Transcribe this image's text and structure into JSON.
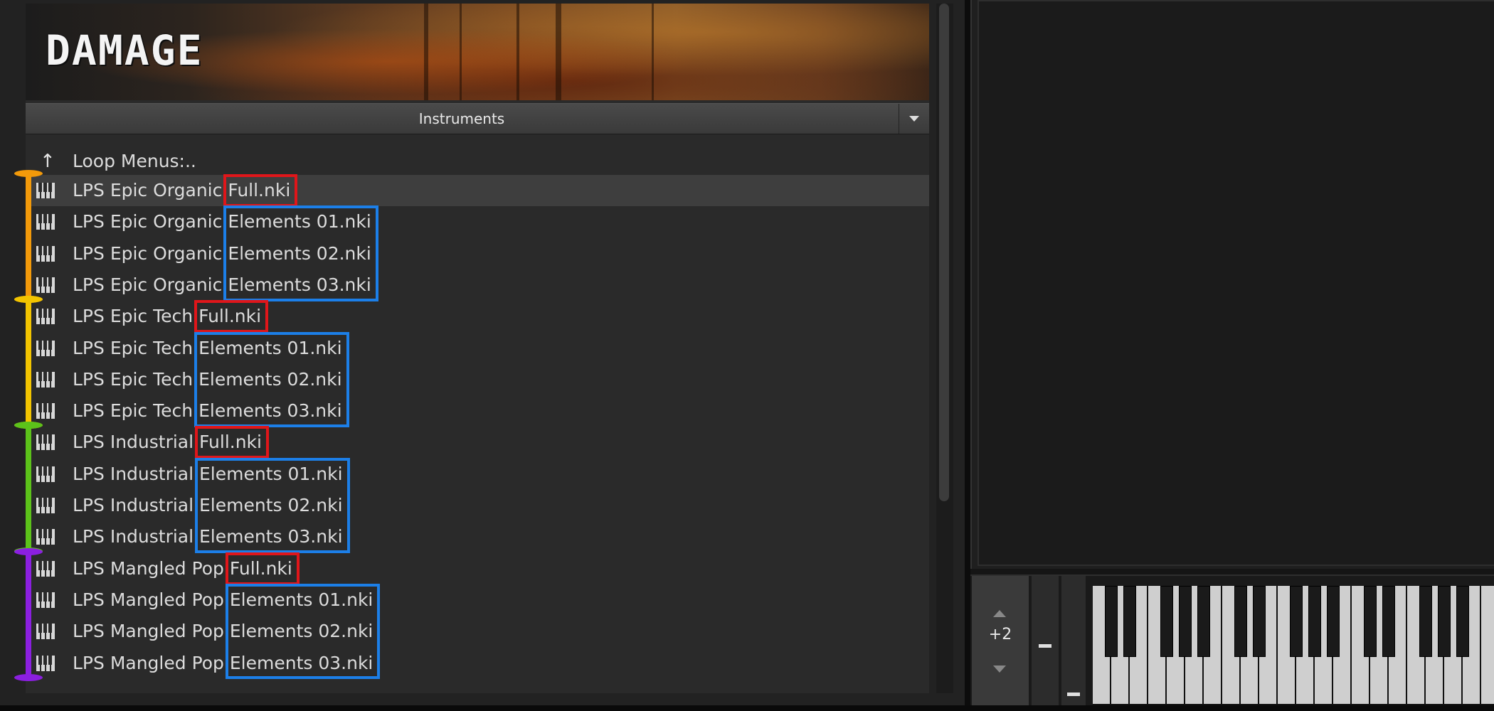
{
  "banner": {
    "title": "DAMAGE"
  },
  "browser": {
    "instruments_label": "Instruments",
    "parent_item": "Loop Menus:..",
    "items": [
      {
        "prefix": "LPS Epic Organic ",
        "file": "Full.nki",
        "group": 0,
        "kind": "full"
      },
      {
        "prefix": "LPS Epic Organic ",
        "file": "Elements 01.nki",
        "group": 0,
        "kind": "elements"
      },
      {
        "prefix": "LPS Epic Organic ",
        "file": "Elements 02.nki",
        "group": 0,
        "kind": "elements"
      },
      {
        "prefix": "LPS Epic Organic ",
        "file": "Elements 03.nki",
        "group": 0,
        "kind": "elements"
      },
      {
        "prefix": "LPS Epic Tech ",
        "file": "Full.nki",
        "group": 1,
        "kind": "full"
      },
      {
        "prefix": "LPS Epic Tech ",
        "file": "Elements 01.nki",
        "group": 1,
        "kind": "elements"
      },
      {
        "prefix": "LPS Epic Tech ",
        "file": "Elements 02.nki",
        "group": 1,
        "kind": "elements"
      },
      {
        "prefix": "LPS Epic Tech ",
        "file": "Elements 03.nki",
        "group": 1,
        "kind": "elements"
      },
      {
        "prefix": "LPS Industrial ",
        "file": "Full.nki",
        "group": 2,
        "kind": "full"
      },
      {
        "prefix": "LPS Industrial ",
        "file": "Elements 01.nki",
        "group": 2,
        "kind": "elements"
      },
      {
        "prefix": "LPS Industrial ",
        "file": "Elements 02.nki",
        "group": 2,
        "kind": "elements"
      },
      {
        "prefix": "LPS Industrial ",
        "file": "Elements 03.nki",
        "group": 2,
        "kind": "elements"
      },
      {
        "prefix": "LPS Mangled Pop ",
        "file": "Full.nki",
        "group": 3,
        "kind": "full"
      },
      {
        "prefix": "LPS Mangled Pop ",
        "file": "Elements 01.nki",
        "group": 3,
        "kind": "elements"
      },
      {
        "prefix": "LPS Mangled Pop ",
        "file": "Elements 02.nki",
        "group": 3,
        "kind": "elements"
      },
      {
        "prefix": "LPS Mangled Pop ",
        "file": "Elements 03.nki",
        "group": 3,
        "kind": "elements"
      }
    ],
    "selected_index": 0
  },
  "colors": {
    "groups": [
      "#f39a0a",
      "#f2c400",
      "#5cc21a",
      "#8b1fe0"
    ],
    "full_highlight": "#e0161a",
    "elements_highlight": "#1c7fe8"
  },
  "keyboard": {
    "octave": "+2"
  }
}
